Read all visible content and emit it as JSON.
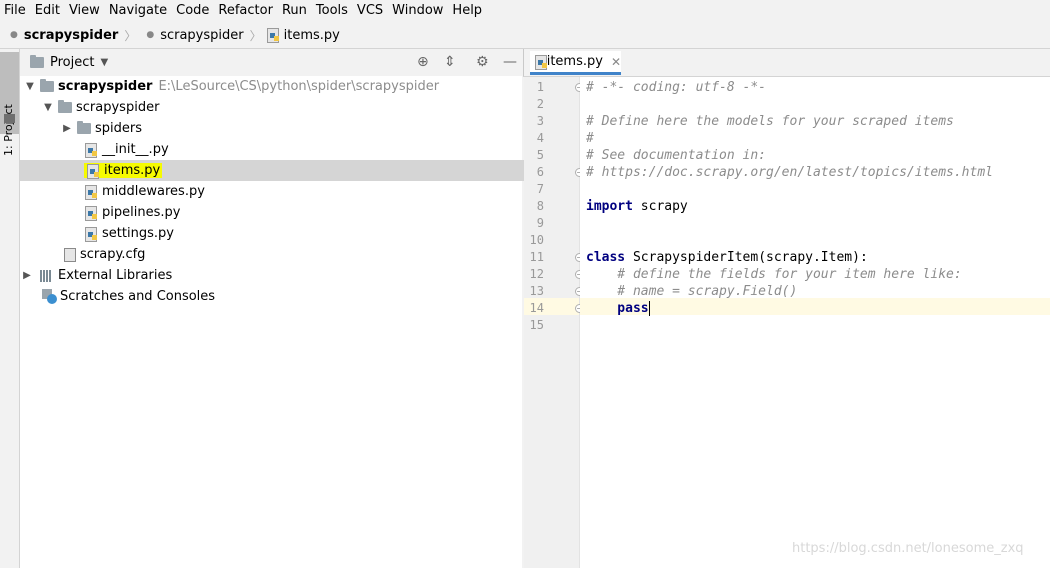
{
  "menu": [
    "File",
    "Edit",
    "View",
    "Navigate",
    "Code",
    "Refactor",
    "Run",
    "Tools",
    "VCS",
    "Window",
    "Help"
  ],
  "breadcrumb": [
    "scrapyspider",
    "scrapyspider",
    "items.py"
  ],
  "sidebar": {
    "tab_label": "1: Project"
  },
  "project": {
    "header": "Project",
    "root_name": "scrapyspider",
    "root_path": "E:\\LeSource\\CS\\python\\spider\\scrapyspider",
    "pkg_name": "scrapyspider",
    "spiders": "spiders",
    "init": "__init__.py",
    "items": "items.py",
    "middlewares": "middlewares.py",
    "pipelines": "pipelines.py",
    "settings": "settings.py",
    "cfg": "scrapy.cfg",
    "ext_libs": "External Libraries",
    "scratches": "Scratches and Consoles"
  },
  "editor": {
    "tab_label": "items.py",
    "line_numbers": [
      "1",
      "2",
      "3",
      "4",
      "5",
      "6",
      "7",
      "8",
      "9",
      "10",
      "11",
      "12",
      "13",
      "14",
      "15"
    ],
    "current_line": 14,
    "code": {
      "l1": "# -*- coding: utf-8 -*-",
      "l3": "# Define here the models for your scraped items",
      "l4": "#",
      "l5": "# See documentation in:",
      "l6": "# https://doc.scrapy.org/en/latest/topics/items.html",
      "l8_kw": "import",
      "l8_rest": " scrapy",
      "l11_kw": "class",
      "l11_rest": " ScrapyspiderItem(scrapy.Item):",
      "l12": "    # define the fields for your item here like:",
      "l13": "    # name = scrapy.Field()",
      "l14": "    pass"
    }
  },
  "watermark": "https://blog.csdn.net/lonesome_zxq",
  "colors": {
    "highlight": "#f6fb00",
    "tab_underline": "#4083c9",
    "keyword": "#000080",
    "comment": "#8c8c8c",
    "current_line": "#fffae3"
  }
}
